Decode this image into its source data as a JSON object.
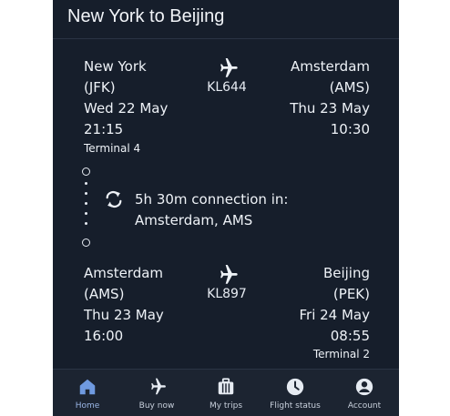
{
  "header": {
    "title": "New York to Beijing"
  },
  "segments": [
    {
      "origin": {
        "city": "New York",
        "code": "(JFK)",
        "date": "Wed 22 May",
        "time": "21:15",
        "terminal": "Terminal 4"
      },
      "flight_no": "KL644",
      "destination": {
        "city": "Amsterdam",
        "code": "(AMS)",
        "date": "Thu 23 May",
        "time": "10:30"
      }
    },
    {
      "origin": {
        "city": "Amsterdam",
        "code": "(AMS)",
        "date": "Thu 23 May",
        "time": "16:00"
      },
      "flight_no": "KL897",
      "destination": {
        "city": "Beijing",
        "code": "(PEK)",
        "date": "Fri 24 May",
        "time": "08:55",
        "terminal": "Terminal 2"
      }
    }
  ],
  "connection": {
    "line1": "5h 30m connection in:",
    "line2": "Amsterdam, AMS",
    "icon": "transfer-icon"
  },
  "nav": {
    "items": [
      {
        "label": "Home",
        "icon": "home-icon",
        "active": true
      },
      {
        "label": "Buy now",
        "icon": "plane-icon"
      },
      {
        "label": "My trips",
        "icon": "suitcase-icon"
      },
      {
        "label": "Flight status",
        "icon": "clock-icon"
      },
      {
        "label": "Account",
        "icon": "account-icon"
      }
    ]
  },
  "colors": {
    "background": "#161e2b",
    "text": "#eef2f7",
    "nav_active": "#9ab6e6"
  }
}
